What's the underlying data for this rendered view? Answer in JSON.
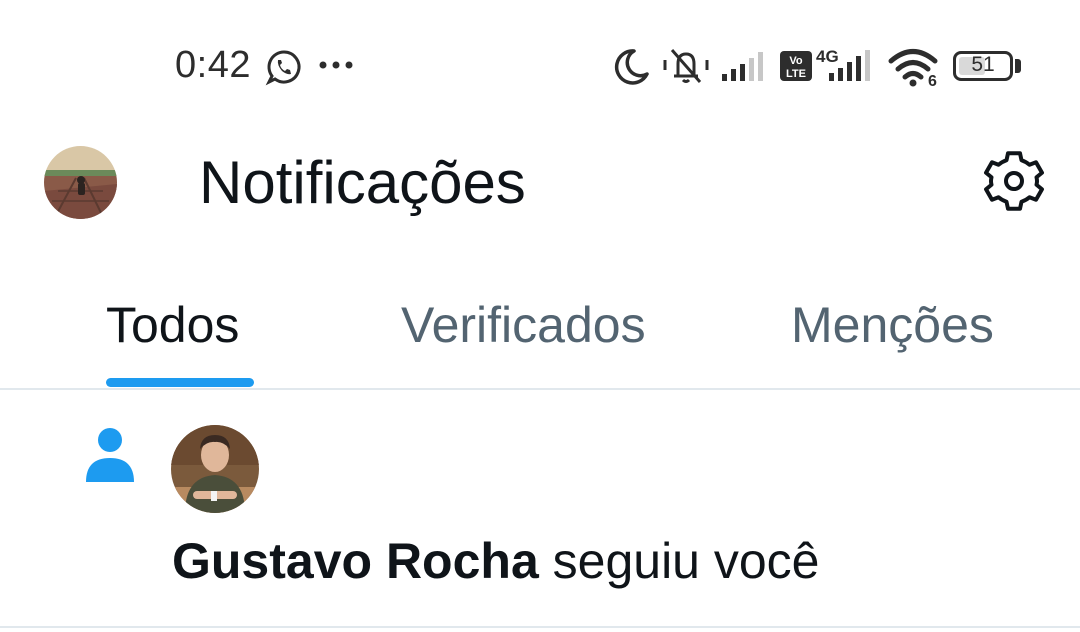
{
  "status_bar": {
    "time": "0:42",
    "battery_level": "51",
    "icons": [
      "whatsapp-icon",
      "more-dots-icon",
      "moon-icon",
      "bell-muted-icon",
      "signal-icon",
      "volte-icon",
      "4g-signal-icon",
      "wifi-icon",
      "battery-icon"
    ],
    "volte_label": "Vo\nLTE",
    "net_label": "4G",
    "wifi_label": "6"
  },
  "header": {
    "title": "Notificações",
    "settings_icon": "gear-icon"
  },
  "tabs": [
    {
      "label": "Todos",
      "active": true
    },
    {
      "label": "Verificados",
      "active": false
    },
    {
      "label": "Menções",
      "active": false
    }
  ],
  "notifications": [
    {
      "type_icon": "person-icon",
      "user_name": "Gustavo Rocha",
      "action": " seguiu você"
    }
  ],
  "colors": {
    "accent": "#1d9bf0",
    "text_primary": "#0f1419",
    "text_secondary": "#536471",
    "divider": "#e1e8ed"
  }
}
